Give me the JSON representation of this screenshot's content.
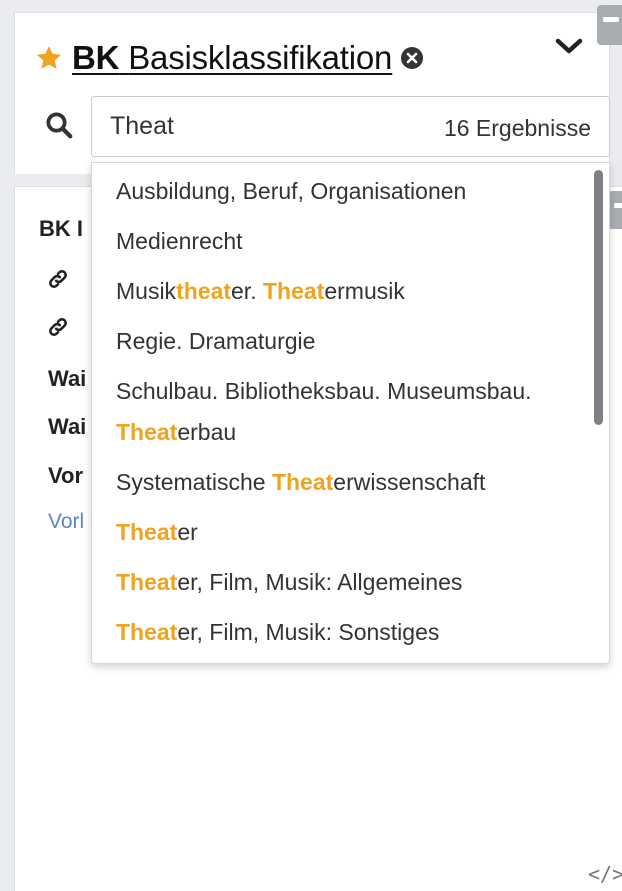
{
  "header": {
    "title_prefix": "BK",
    "title_rest": "Basisklassifikation",
    "star_icon": "star-icon",
    "remove_icon": "remove-circle-icon",
    "collapse_icon": "chevron-down-icon",
    "accent_color": "#f0a31e"
  },
  "search": {
    "value": "Theat",
    "placeholder": "",
    "result_count": "16 Ergebnisse"
  },
  "background_panel": {
    "labels": [
      "BK I",
      "Wai",
      "Wai",
      "Vor"
    ],
    "link": "Vorl"
  },
  "dropdown": {
    "items": [
      {
        "parts": [
          "Ausbildung, Beruf, Organisationen"
        ]
      },
      {
        "parts": [
          "Medienrecht"
        ]
      },
      {
        "parts": [
          "Musik",
          "theat",
          "er. ",
          "Theat",
          "ermusik"
        ]
      },
      {
        "parts": [
          "Regie. Dramaturgie"
        ]
      },
      {
        "line1": "Schulbau. Bibliotheksbau. Museumsbau.",
        "line2_hl": "Theat",
        "line2_rest": "erbau"
      },
      {
        "parts": [
          "Systematische ",
          "Theat",
          "erwissenschaft"
        ]
      },
      {
        "parts": [
          "",
          "Theat",
          "er"
        ]
      },
      {
        "parts": [
          "",
          "Theat",
          "er, Film, Musik: Allgemeines"
        ]
      },
      {
        "parts": [
          "",
          "Theat",
          "er, Film, Musik: Sonstiges"
        ]
      }
    ]
  },
  "footer": {
    "code_icon_text": "</>"
  }
}
